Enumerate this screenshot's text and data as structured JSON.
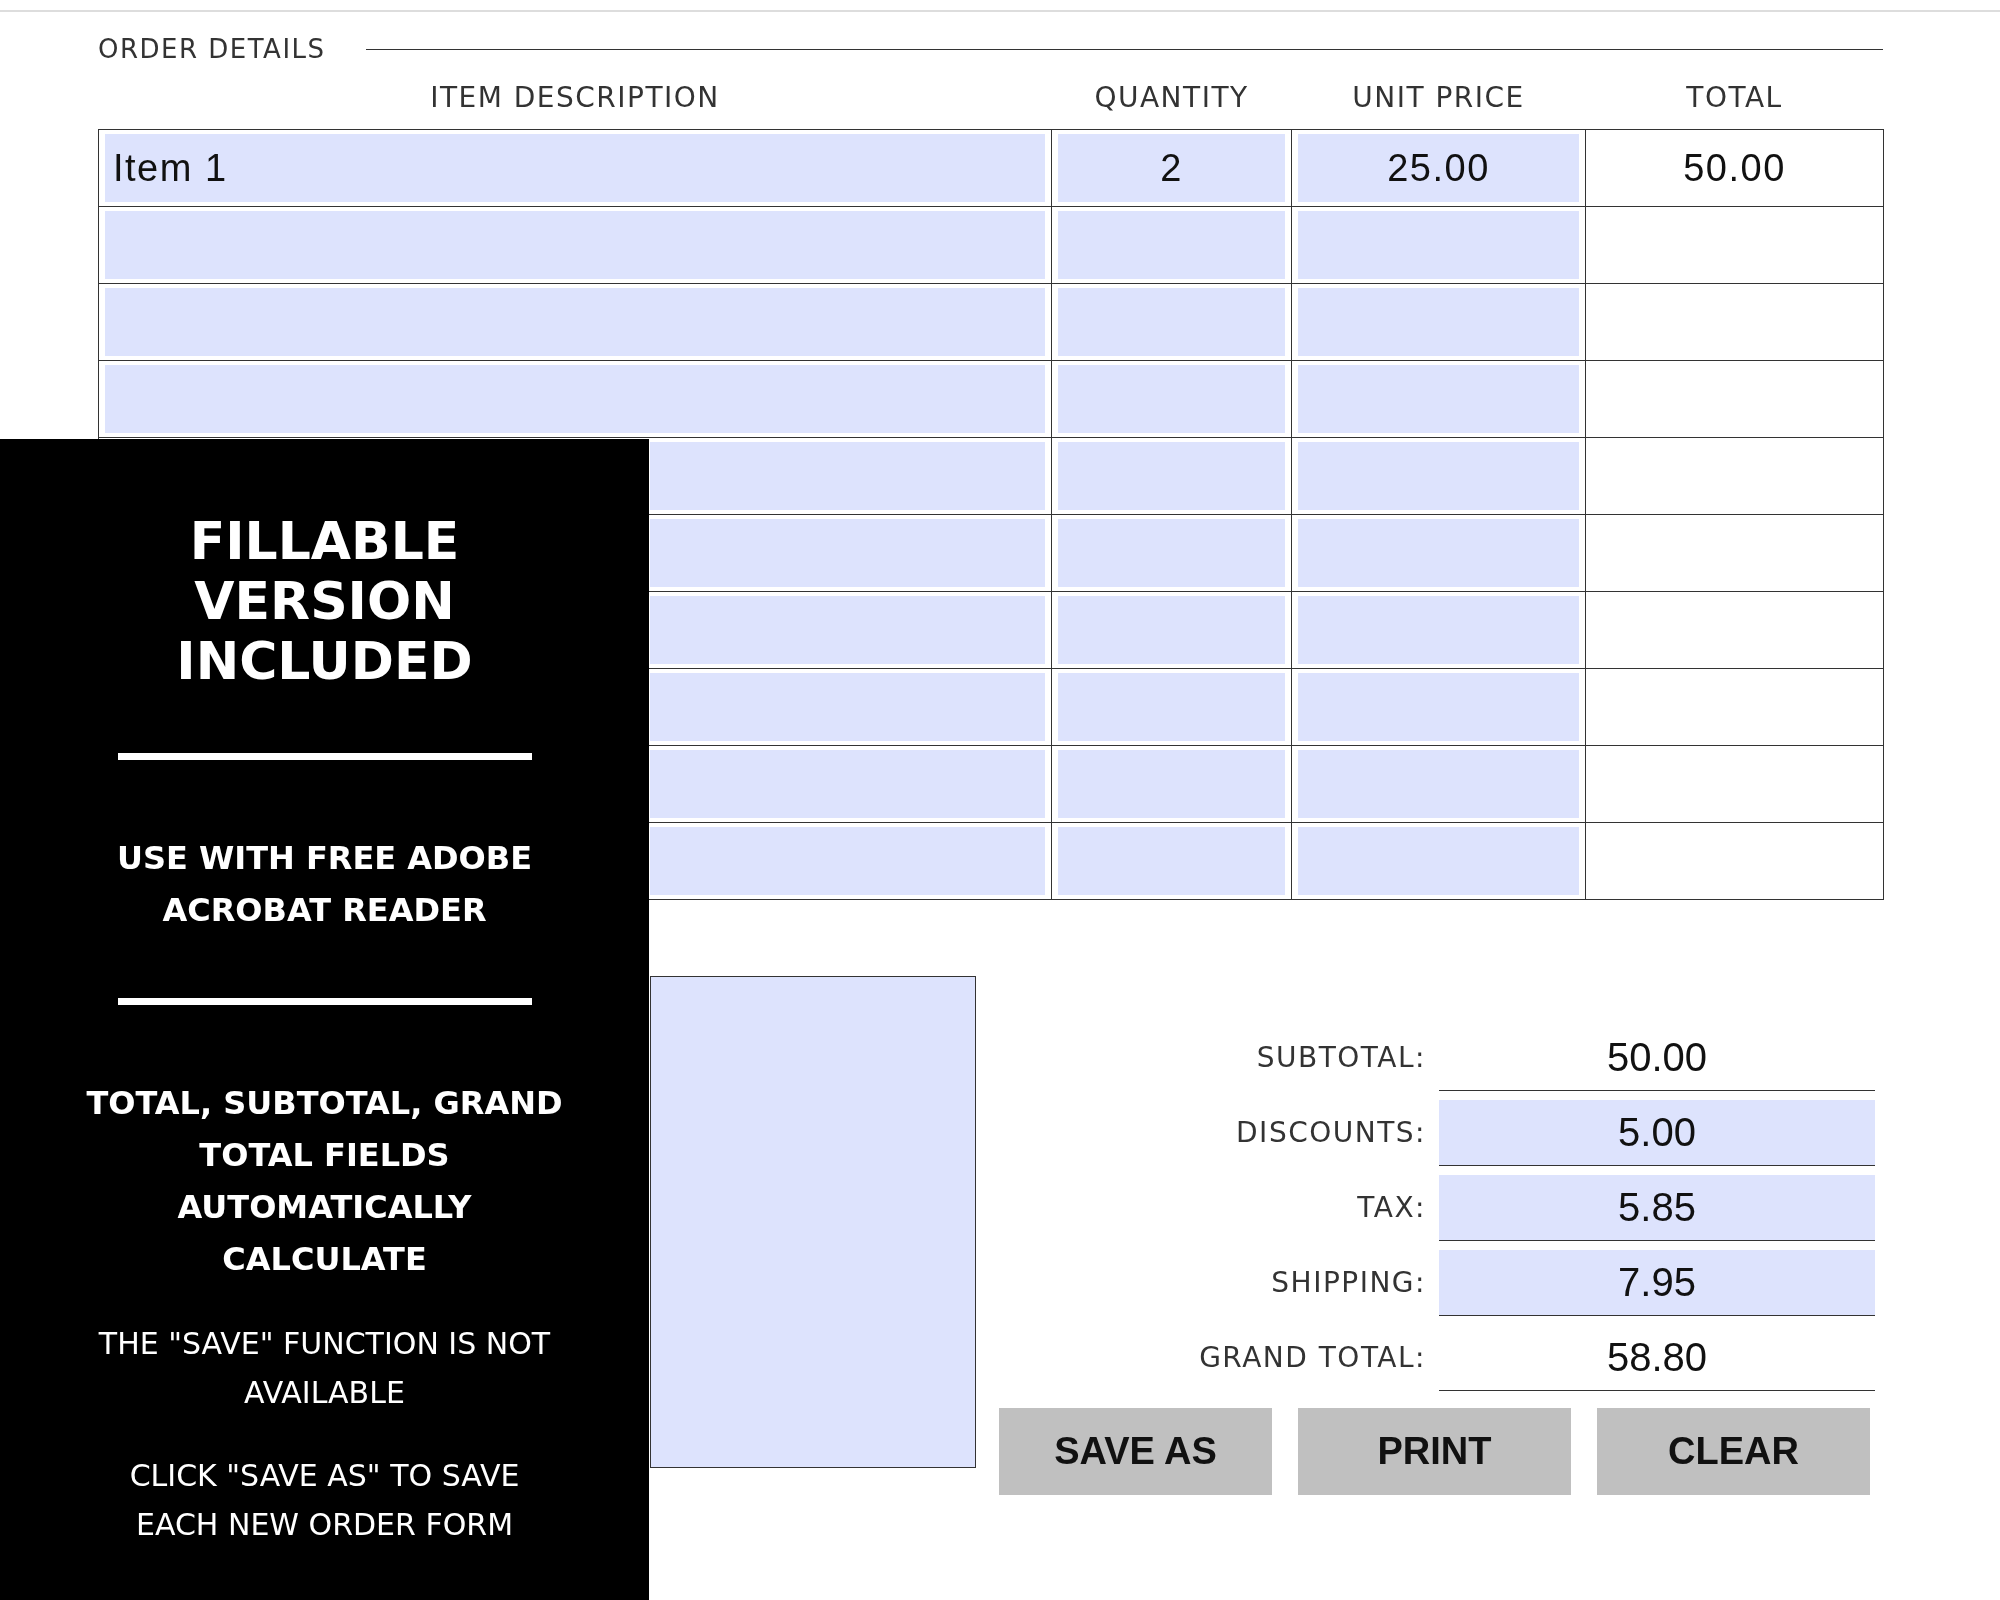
{
  "section_title": "ORDER DETAILS",
  "table": {
    "columns": [
      "ITEM DESCRIPTION",
      "QUANTITY",
      "UNIT PRICE",
      "TOTAL"
    ],
    "rows": [
      {
        "description": "Item 1",
        "quantity": "2",
        "unit_price": "25.00",
        "total": "50.00"
      },
      {},
      {},
      {},
      {},
      {},
      {},
      {},
      {},
      {}
    ]
  },
  "notes_field": {
    "kind": "field"
  },
  "totals": [
    {
      "label": "SUBTOTAL:",
      "value": "50.00",
      "kind": "computed"
    },
    {
      "label": "DISCOUNTS:",
      "value": "5.00",
      "kind": "field"
    },
    {
      "label": "TAX:",
      "value": "5.85",
      "kind": "field"
    },
    {
      "label": "SHIPPING:",
      "value": "7.95",
      "kind": "field"
    },
    {
      "label": "GRAND TOTAL:",
      "value": "58.80",
      "kind": "computed"
    }
  ],
  "buttons": [
    "SAVE AS",
    "PRINT",
    "CLEAR"
  ],
  "promo_panel": [
    {
      "kind": "heading",
      "text": "FILLABLE VERSION INCLUDED"
    },
    {
      "kind": "rule"
    },
    {
      "kind": "subheading",
      "text": "USE WITH FREE ADOBE ACROBAT READER"
    },
    {
      "kind": "rule"
    },
    {
      "kind": "subheading",
      "text": "TOTAL, SUBTOTAL, GRAND TOTAL FIELDS AUTOMATICALLY CALCULATE"
    },
    {
      "kind": "note",
      "text": "THE \"SAVE\" FUNCTION IS NOT AVAILABLE"
    },
    {
      "kind": "note",
      "text": "CLICK \"SAVE AS\" TO SAVE EACH NEW ORDER FORM"
    }
  ]
}
